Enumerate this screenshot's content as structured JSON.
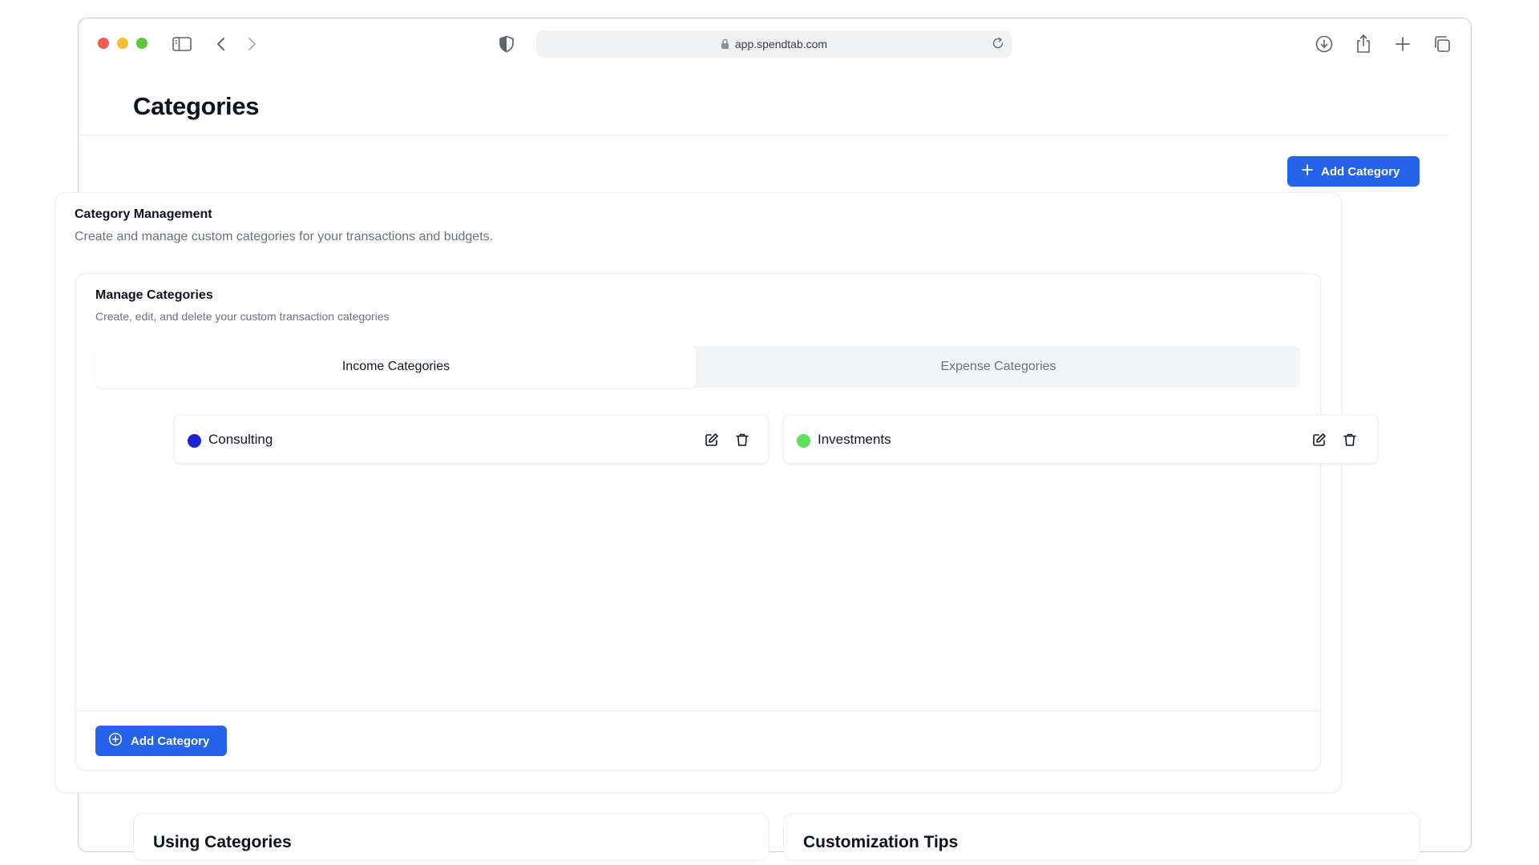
{
  "browser": {
    "url": "app.spendtab.com"
  },
  "page": {
    "title": "Categories",
    "add_button_label": "Add Category"
  },
  "category_management": {
    "title": "Category Management",
    "description": "Create and manage custom categories for your transactions and budgets."
  },
  "manage_categories": {
    "title": "Manage Categories",
    "description": "Create, edit, and delete your custom transaction categories",
    "tabs": [
      {
        "label": "Income Categories",
        "active": true
      },
      {
        "label": "Expense Categories",
        "active": false
      }
    ],
    "items": [
      {
        "name": "Consulting",
        "color": "#1e22d6"
      },
      {
        "name": "Investments",
        "color": "#5fe05a"
      }
    ],
    "add_button_label": "Add Category"
  },
  "sections": {
    "using_categories": "Using Categories",
    "customization_tips": "Customization Tips"
  },
  "colors": {
    "accent": "#2563eb"
  }
}
